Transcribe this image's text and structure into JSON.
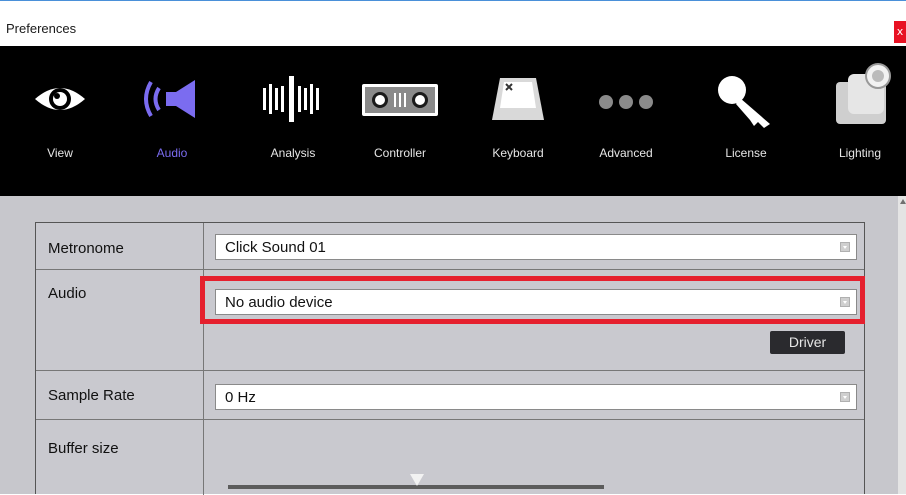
{
  "window": {
    "title": "Preferences",
    "close_label": "x"
  },
  "toolbar": {
    "items": [
      {
        "label": "View",
        "icon": "eye-icon",
        "active": false
      },
      {
        "label": "Audio",
        "icon": "speaker-icon",
        "active": true
      },
      {
        "label": "Analysis",
        "icon": "waveform-bars-icon",
        "active": false
      },
      {
        "label": "Controller",
        "icon": "controller-icon",
        "active": false
      },
      {
        "label": "Keyboard",
        "icon": "keyboard-key-icon",
        "active": false
      },
      {
        "label": "Advanced",
        "icon": "three-dots-icon",
        "active": false
      },
      {
        "label": "License",
        "icon": "key-icon",
        "active": false
      },
      {
        "label": "Lighting",
        "icon": "moving-head-light-icon",
        "active": false
      }
    ]
  },
  "settings": {
    "metronome": {
      "label": "Metronome",
      "value": "Click Sound 01"
    },
    "audio": {
      "label": "Audio",
      "value": "No audio device",
      "driver_label": "Driver"
    },
    "sample_rate": {
      "label": "Sample Rate",
      "value": "0 Hz"
    },
    "buffer_size": {
      "label": "Buffer size"
    }
  },
  "colors": {
    "toolbar_bg": "#000000",
    "active_accent": "#7b6cf0",
    "panel_bg": "#c7c7cc",
    "highlight": "#e5202e"
  }
}
